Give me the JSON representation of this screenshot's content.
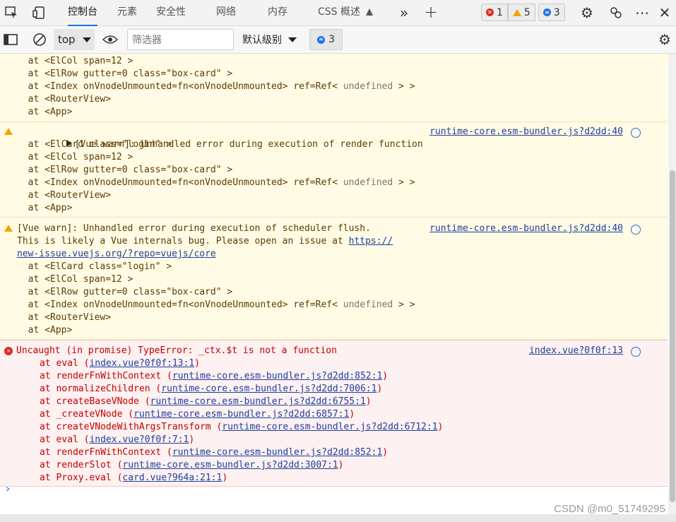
{
  "tabs": {
    "console": "控制台",
    "elements": "元素",
    "security": "安全性",
    "network": "网络",
    "memory": "内存",
    "css": "CSS 概述"
  },
  "counts": {
    "errors": "1",
    "warnings": "5",
    "messages": "3"
  },
  "toolbar": {
    "context": "top",
    "filter_placeholder": "筛选器",
    "level": "默认级别",
    "issues": "3"
  },
  "logs": {
    "w0": {
      "lines": [
        "  at <ElCol span=12 >",
        "  at <ElRow gutter=0 class=\"box-card\" >",
        "  at <Index onVnodeUnmounted=fn<onVnodeUnmounted> ref=Ref<",
        "  at <RouterView>",
        "  at <App>"
      ],
      "undef": "undefined",
      "tail": "> >"
    },
    "w1": {
      "head": "[Vue warn]: Unhandled error during execution of render function",
      "src": "runtime-core.esm-bundler.js?d2dd:40",
      "lines": [
        "  at <ElCard class=\"login\" >",
        "  at <ElCol span=12 >",
        "  at <ElRow gutter=0 class=\"box-card\" >",
        "  at <Index onVnodeUnmounted=fn<onVnodeUnmounted> ref=Ref<",
        "  at <RouterView>",
        "  at <App>"
      ],
      "undef": "undefined",
      "tail": "> >"
    },
    "w2": {
      "head": "[Vue warn]: Unhandled error during execution of scheduler flush.",
      "line2": "This is likely a Vue internals bug. Please open an issue at",
      "link1": "https://",
      "link2": "new-issue.vuejs.org/?repo=vuejs/core",
      "src": "runtime-core.esm-bundler.js?d2dd:40",
      "lines": [
        "  at <ElCard class=\"login\" >",
        "  at <ElCol span=12 >",
        "  at <ElRow gutter=0 class=\"box-card\" >",
        "  at <Index onVnodeUnmounted=fn<onVnodeUnmounted> ref=Ref<",
        "  at <RouterView>",
        "  at <App>"
      ],
      "undef": "undefined",
      "tail": "> >"
    },
    "err": {
      "head": "Uncaught (in promise) TypeError: _ctx.$t is not a function",
      "src": "index.vue?0f0f:13",
      "frames": [
        {
          "fn": "eval",
          "loc": "index.vue?0f0f:13:1"
        },
        {
          "fn": "renderFnWithContext",
          "loc": "runtime-core.esm-bundler.js?d2dd:852:1"
        },
        {
          "fn": "normalizeChildren",
          "loc": "runtime-core.esm-bundler.js?d2dd:7006:1"
        },
        {
          "fn": "createBaseVNode",
          "loc": "runtime-core.esm-bundler.js?d2dd:6755:1"
        },
        {
          "fn": "_createVNode",
          "loc": "runtime-core.esm-bundler.js?d2dd:6857:1"
        },
        {
          "fn": "createVNodeWithArgsTransform",
          "loc": "runtime-core.esm-bundler.js?d2dd:6712:1"
        },
        {
          "fn": "eval",
          "loc": "index.vue?0f0f:7:1"
        },
        {
          "fn": "renderFnWithContext",
          "loc": "runtime-core.esm-bundler.js?d2dd:852:1"
        },
        {
          "fn": "renderSlot",
          "loc": "runtime-core.esm-bundler.js?d2dd:3007:1"
        },
        {
          "fn": "Proxy.eval",
          "loc": "card.vue?964a:21:1"
        }
      ]
    }
  },
  "watermark": "CSDN @m0_51749295",
  "colors": {
    "accent": "#1a73e8",
    "warn_bg": "#fffbe5",
    "err_bg": "#fdf1f1",
    "err_text": "#c40000"
  }
}
